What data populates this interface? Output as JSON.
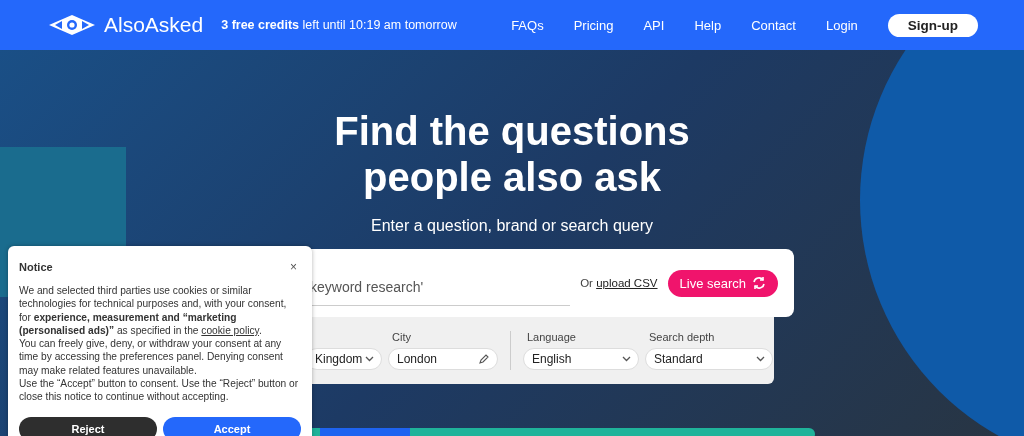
{
  "header": {
    "brand": "AlsoAsked",
    "credits": "**3 free credits** left until 10:19 am tomorrow",
    "nav": [
      "FAQs",
      "Pricing",
      "API",
      "Help",
      "Contact",
      "Login"
    ],
    "signup": "Sign-up"
  },
  "hero": {
    "title": "Find the questions people also ask",
    "subtitle": "Enter a question, brand or search query"
  },
  "search": {
    "placeholder": "keyword research'",
    "upload_prefix": "Or",
    "upload_link": "upload CSV",
    "button": "Live search",
    "filters": [
      {
        "value": "Kingdom",
        "kind": "dropdown"
      },
      {
        "label": "City",
        "value": "London",
        "kind": "editable"
      },
      {
        "label": "Language",
        "value": "English",
        "kind": "dropdown"
      },
      {
        "label": "Search depth",
        "value": "Standard",
        "kind": "dropdown"
      }
    ]
  },
  "notice": {
    "title": "Notice",
    "close": "×",
    "body": [
      "We and selected third parties use cookies or similar technologies for technical purposes and, with your consent, for **experience, measurement and “marketing (personalised ads)”** as specified in the ",
      "You can freely give, deny, or withdraw your consent at any time by accessing the preferences panel. Denying consent may make related features unavailable.",
      "Use the “Accept” button to consent. Use the “Reject” button or close this notice to continue without accepting."
    ],
    "policy_link": "cookie policy",
    "policy_end": ".",
    "buttons": [
      {
        "label": "Reject",
        "kind": "secondary"
      },
      {
        "label": "Accept",
        "kind": "primary"
      }
    ]
  }
}
